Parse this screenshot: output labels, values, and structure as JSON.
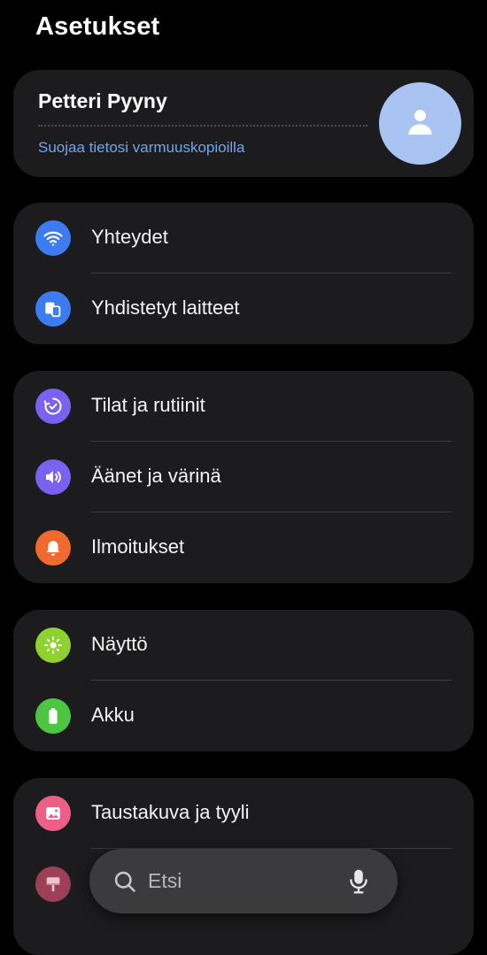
{
  "header": {
    "title": "Asetukset"
  },
  "profile": {
    "name": "Petteri Pyyny",
    "backup_link": "Suojaa tietosi varmuuskopioilla"
  },
  "groups": [
    {
      "items": [
        {
          "label": "Yhteydet",
          "icon": "wifi-icon",
          "color": "#3d7cf0"
        },
        {
          "label": "Yhdistetyt laitteet",
          "icon": "connected-devices-icon",
          "color": "#3d7cf0"
        }
      ]
    },
    {
      "items": [
        {
          "label": "Tilat ja rutiinit",
          "icon": "modes-routines-icon",
          "color": "#7b61f0"
        },
        {
          "label": "Äänet ja värinä",
          "icon": "volume-icon",
          "color": "#7b61f0"
        },
        {
          "label": "Ilmoitukset",
          "icon": "bell-icon",
          "color": "#ef6a2e"
        }
      ]
    },
    {
      "items": [
        {
          "label": "Näyttö",
          "icon": "sun-icon",
          "color": "#8fd12f"
        },
        {
          "label": "Akku",
          "icon": "battery-icon",
          "color": "#4cc640"
        }
      ]
    },
    {
      "items": [
        {
          "label": "Taustakuva ja tyyli",
          "icon": "wallpaper-icon",
          "color": "#ec5f87"
        },
        {
          "label": "",
          "icon": "theme-brush-icon",
          "color": "#ec5f87"
        }
      ]
    }
  ],
  "search": {
    "placeholder": "Etsi"
  }
}
